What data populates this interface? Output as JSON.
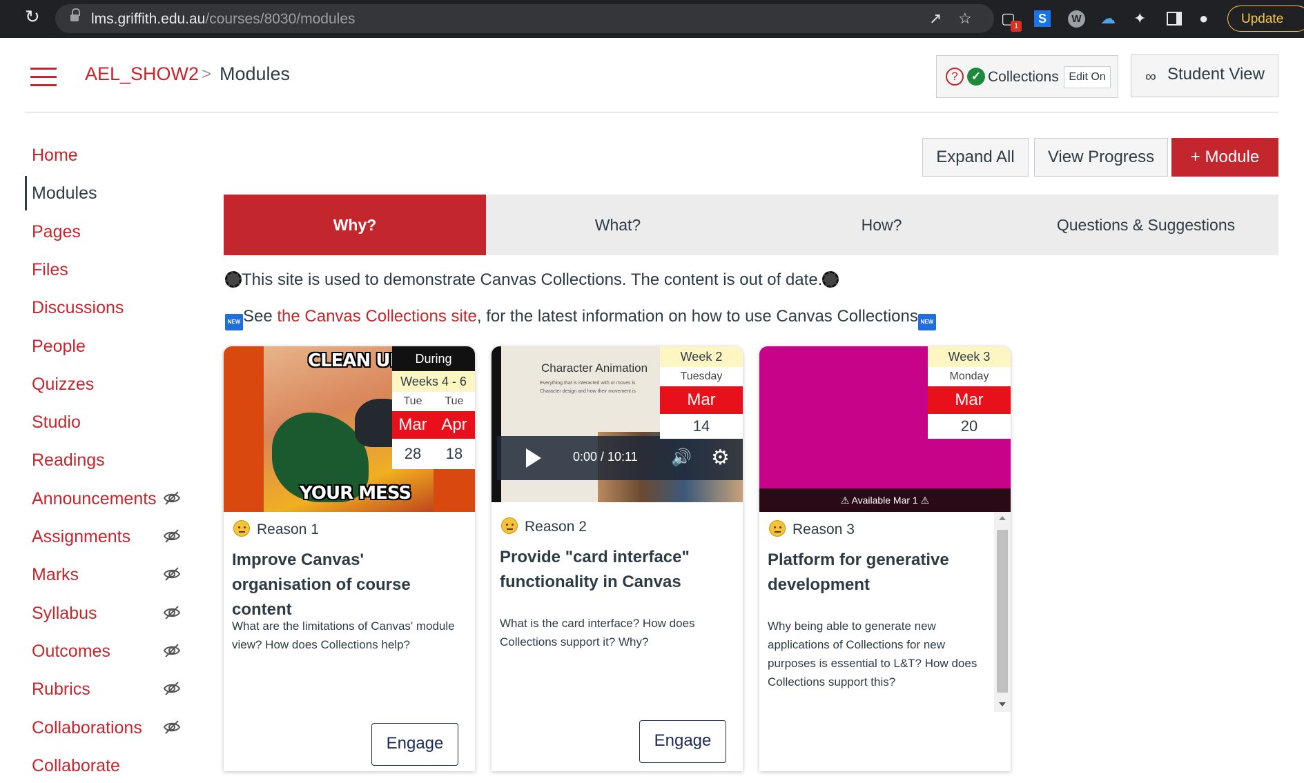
{
  "browser": {
    "url_host": "lms.griffith.edu.au",
    "url_path": "/courses/8030/modules",
    "update_label": "Update",
    "extension_badge": "1"
  },
  "header": {
    "course": "AEL_SHOW2",
    "separator": ">",
    "page": "Modules",
    "collections_label": "Collections",
    "edit_on_label": "Edit On",
    "student_view_label": "Student View"
  },
  "sidebar": {
    "items": [
      {
        "label": "Home",
        "hidden": false,
        "active": false
      },
      {
        "label": "Modules",
        "hidden": false,
        "active": true
      },
      {
        "label": "Pages",
        "hidden": false,
        "active": false
      },
      {
        "label": "Files",
        "hidden": false,
        "active": false
      },
      {
        "label": "Discussions",
        "hidden": false,
        "active": false
      },
      {
        "label": "People",
        "hidden": false,
        "active": false
      },
      {
        "label": "Quizzes",
        "hidden": false,
        "active": false
      },
      {
        "label": "Studio",
        "hidden": false,
        "active": false
      },
      {
        "label": "Readings",
        "hidden": false,
        "active": false
      },
      {
        "label": "Announcements",
        "hidden": true,
        "active": false
      },
      {
        "label": "Assignments",
        "hidden": true,
        "active": false
      },
      {
        "label": "Marks",
        "hidden": true,
        "active": false
      },
      {
        "label": "Syllabus",
        "hidden": true,
        "active": false
      },
      {
        "label": "Outcomes",
        "hidden": true,
        "active": false
      },
      {
        "label": "Rubrics",
        "hidden": true,
        "active": false
      },
      {
        "label": "Collaborations",
        "hidden": true,
        "active": false
      },
      {
        "label": "Collaborate",
        "hidden": false,
        "active": false
      }
    ]
  },
  "toolbar": {
    "expand_all": "Expand All",
    "view_progress": "View Progress",
    "add_module": "+ Module"
  },
  "tabs": [
    "Why?",
    "What?",
    "How?",
    "Questions & Suggestions"
  ],
  "notices": {
    "line1": "This site is used to demonstrate Canvas Collections. The content is out of date.",
    "line2_prefix": "See ",
    "line2_link": "the Canvas Collections site",
    "line2_suffix": ", for the latest information on how to use Canvas Collections"
  },
  "cards": [
    {
      "label": "Reason 1",
      "title": "Improve Canvas' organisation of course content",
      "description": "What are the  limitations of Canvas' module view? How does Collections help?",
      "action": "Engage",
      "image_text_top": "CLEAN UP",
      "image_text_bottom": "YOUR MESS",
      "date": {
        "top": "During",
        "week": "Weeks 4 - 6",
        "days": [
          "Tue",
          "Tue"
        ],
        "months": [
          "Mar",
          "Apr"
        ],
        "dates": [
          "28",
          "18"
        ]
      }
    },
    {
      "label": "Reason 2",
      "title": "Provide \"card interface\" functionality in Canvas",
      "description": "What is the card interface? How does Collections support it? Why?",
      "action": "Engage",
      "video": {
        "slide_title": "Character Animation",
        "bullet1": "Everything that is interacted with or moves is",
        "bullet2": "Character design and how their movement is",
        "time": "0:00 / 10:11"
      },
      "date": {
        "week": "Week 2",
        "day": "Tuesday",
        "month": "Mar",
        "date": "14"
      }
    },
    {
      "label": "Reason 3",
      "title": "Platform for generative development",
      "description": "Why being able to generate new applications of Collections for new purposes is essential to L&T? How does Collections support this?",
      "availability": "Available Mar 1",
      "date": {
        "week": "Week 3",
        "day": "Monday",
        "month": "Mar",
        "date": "20"
      }
    }
  ],
  "colors": {
    "brand_red": "#c4262d",
    "badge_red": "#e8101a",
    "card3_bg": "#c7038a",
    "text": "#2d3b45"
  }
}
